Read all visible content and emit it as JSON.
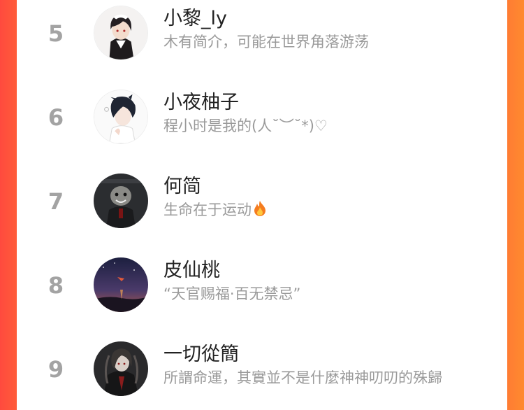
{
  "colors": {
    "accent_left": "#ff4a3e",
    "accent_right": "#ff8a2f",
    "rank_number": "#a3a3a3",
    "name_text": "#222222",
    "bio_text": "#9a9a9a"
  },
  "ranking": {
    "items": [
      {
        "rank": "5",
        "name": "小黎_ly",
        "bio": "木有简介，可能在世界角落游荡",
        "avatar_icon": "avatar-anime-boy-maid"
      },
      {
        "rank": "6",
        "name": "小夜柚子",
        "bio": "程小时是我的(人˘︶˘*)♡",
        "avatar_icon": "avatar-anime-boy-dark-hair"
      },
      {
        "rank": "7",
        "name": "何简",
        "bio": "生命在于运动",
        "bio_emoji": "fire-icon",
        "avatar_icon": "avatar-dark-character"
      },
      {
        "rank": "8",
        "name": "皮仙桃",
        "bio": "“天官赐福·百无禁忌”",
        "avatar_icon": "avatar-night-sky"
      },
      {
        "rank": "9",
        "name": "一切從簡",
        "bio": "所謂命運，其實並不是什麼神神叨叨的殊歸",
        "avatar_icon": "avatar-dark-anime-warrior"
      }
    ]
  }
}
